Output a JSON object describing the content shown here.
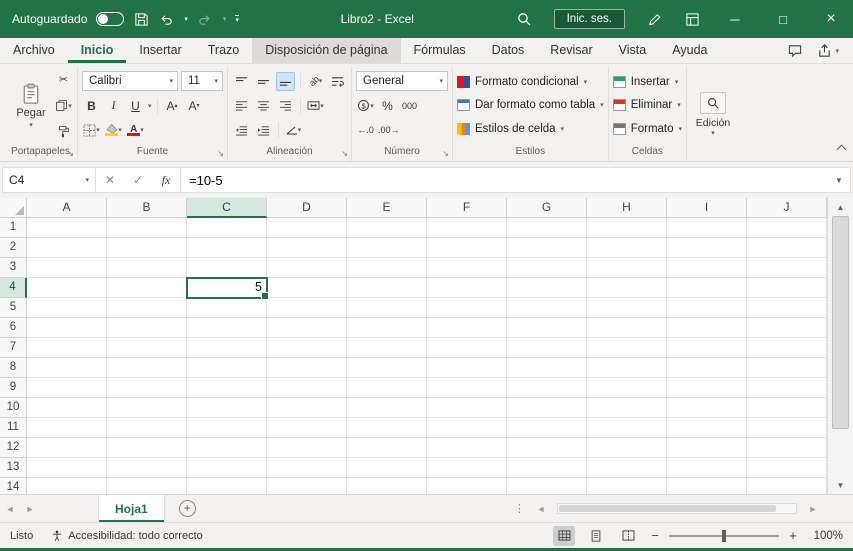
{
  "titlebar": {
    "autosave": "Autoguardado",
    "title": "Libro2  -  Excel",
    "signin": "Inic. ses."
  },
  "tabs": [
    "Archivo",
    "Inicio",
    "Insertar",
    "Trazo",
    "Disposición de página",
    "Fórmulas",
    "Datos",
    "Revisar",
    "Vista",
    "Ayuda"
  ],
  "active_tab": "Inicio",
  "highlighted_tab": "Disposición de página",
  "ribbon": {
    "clipboard": {
      "paste": "Pegar",
      "label": "Portapapeles"
    },
    "font": {
      "name": "Calibri",
      "size": "11",
      "bold": "B",
      "italic": "I",
      "underline": "U",
      "grow": "A",
      "shrink": "A",
      "color_a": "A",
      "label": "Fuente"
    },
    "alignment": {
      "orientation": "ab",
      "label": "Alineación"
    },
    "number": {
      "format": "General",
      "currency": "$",
      "percent": "%",
      "thousands": "000",
      "inc_dec": "←.0",
      "dec_dec": ".00→",
      "label": "Número"
    },
    "styles": {
      "conditional": "Formato condicional",
      "table": "Dar formato como tabla",
      "cell": "Estilos de celda",
      "label": "Estilos"
    },
    "cells": {
      "insert": "Insertar",
      "del": "Eliminar",
      "format": "Formato",
      "label": "Celdas"
    },
    "editing": {
      "label": "Edición"
    }
  },
  "formula_bar": {
    "name_box": "C4",
    "fx": "fx",
    "formula": "=10-5"
  },
  "grid": {
    "columns": [
      "A",
      "B",
      "C",
      "D",
      "E",
      "F",
      "G",
      "H",
      "I",
      "J"
    ],
    "rows": [
      "1",
      "2",
      "3",
      "4",
      "5",
      "6",
      "7",
      "8",
      "9",
      "10",
      "11",
      "12",
      "13",
      "14"
    ],
    "active": {
      "col": "C",
      "row": "4",
      "value": "5"
    }
  },
  "sheets": {
    "active": "Hoja1"
  },
  "status": {
    "mode": "Listo",
    "accessibility": "Accesibilidad: todo correcto",
    "zoom": "100%"
  },
  "icons": {
    "minimize": "─",
    "maximize": "□",
    "close": "×",
    "cancel": "✕",
    "check": "✓",
    "scissors": "✂",
    "chevron": "▾",
    "up": "▲",
    "down": "▼",
    "left": "◄",
    "right": "►",
    "plus": "+",
    "minus": "−",
    "dots": "⋮",
    "launcher": "↘"
  },
  "colors": {
    "brand_green": "#217346",
    "selection_border": "#217346",
    "header_highlight": "#d6e8dd"
  }
}
